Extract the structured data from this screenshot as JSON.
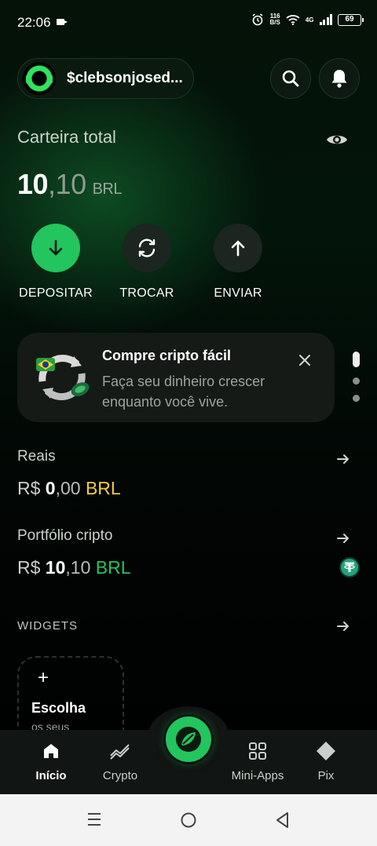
{
  "status_bar": {
    "time": "22:06",
    "net_speed_top": "116",
    "net_speed_bottom": "B/S",
    "network": "4G",
    "battery": "69"
  },
  "header": {
    "username": "$clebsonjosed...",
    "icons": [
      "search-icon",
      "bell-icon"
    ]
  },
  "wallet": {
    "label": "Carteira total",
    "balance_int": "10",
    "balance_dec": ",10",
    "currency": "BRL",
    "actions": [
      {
        "label": "DEPOSITAR",
        "icon": "arrow-down-icon"
      },
      {
        "label": "TROCAR",
        "icon": "refresh-icon"
      },
      {
        "label": "ENVIAR",
        "icon": "arrow-up-icon"
      }
    ]
  },
  "promo": {
    "title": "Compre cripto fácil",
    "subtitle": "Faça seu dinheiro crescer enquanto você vive."
  },
  "accounts": [
    {
      "title": "Reais",
      "prefix": "R$ ",
      "int": "0",
      "dec": ",00",
      "currency": "BRL"
    },
    {
      "title": "Portfólio cripto",
      "prefix": "R$ ",
      "int": "10",
      "dec": ",10",
      "currency": "BRL"
    }
  ],
  "widgets": {
    "label": "WIDGETS",
    "card_title": "Escolha",
    "card_sub": "os seus"
  },
  "bottom_nav": [
    {
      "label": "Início",
      "icon": "home-icon",
      "active": true
    },
    {
      "label": "Crypto",
      "icon": "chart-icon",
      "active": false
    },
    {
      "label": "Mini-Apps",
      "icon": "grid-icon",
      "active": false
    },
    {
      "label": "Pix",
      "icon": "pix-icon",
      "active": false
    }
  ],
  "colors": {
    "accent": "#22c55e",
    "brl_yellow": "#f2cc3a"
  }
}
